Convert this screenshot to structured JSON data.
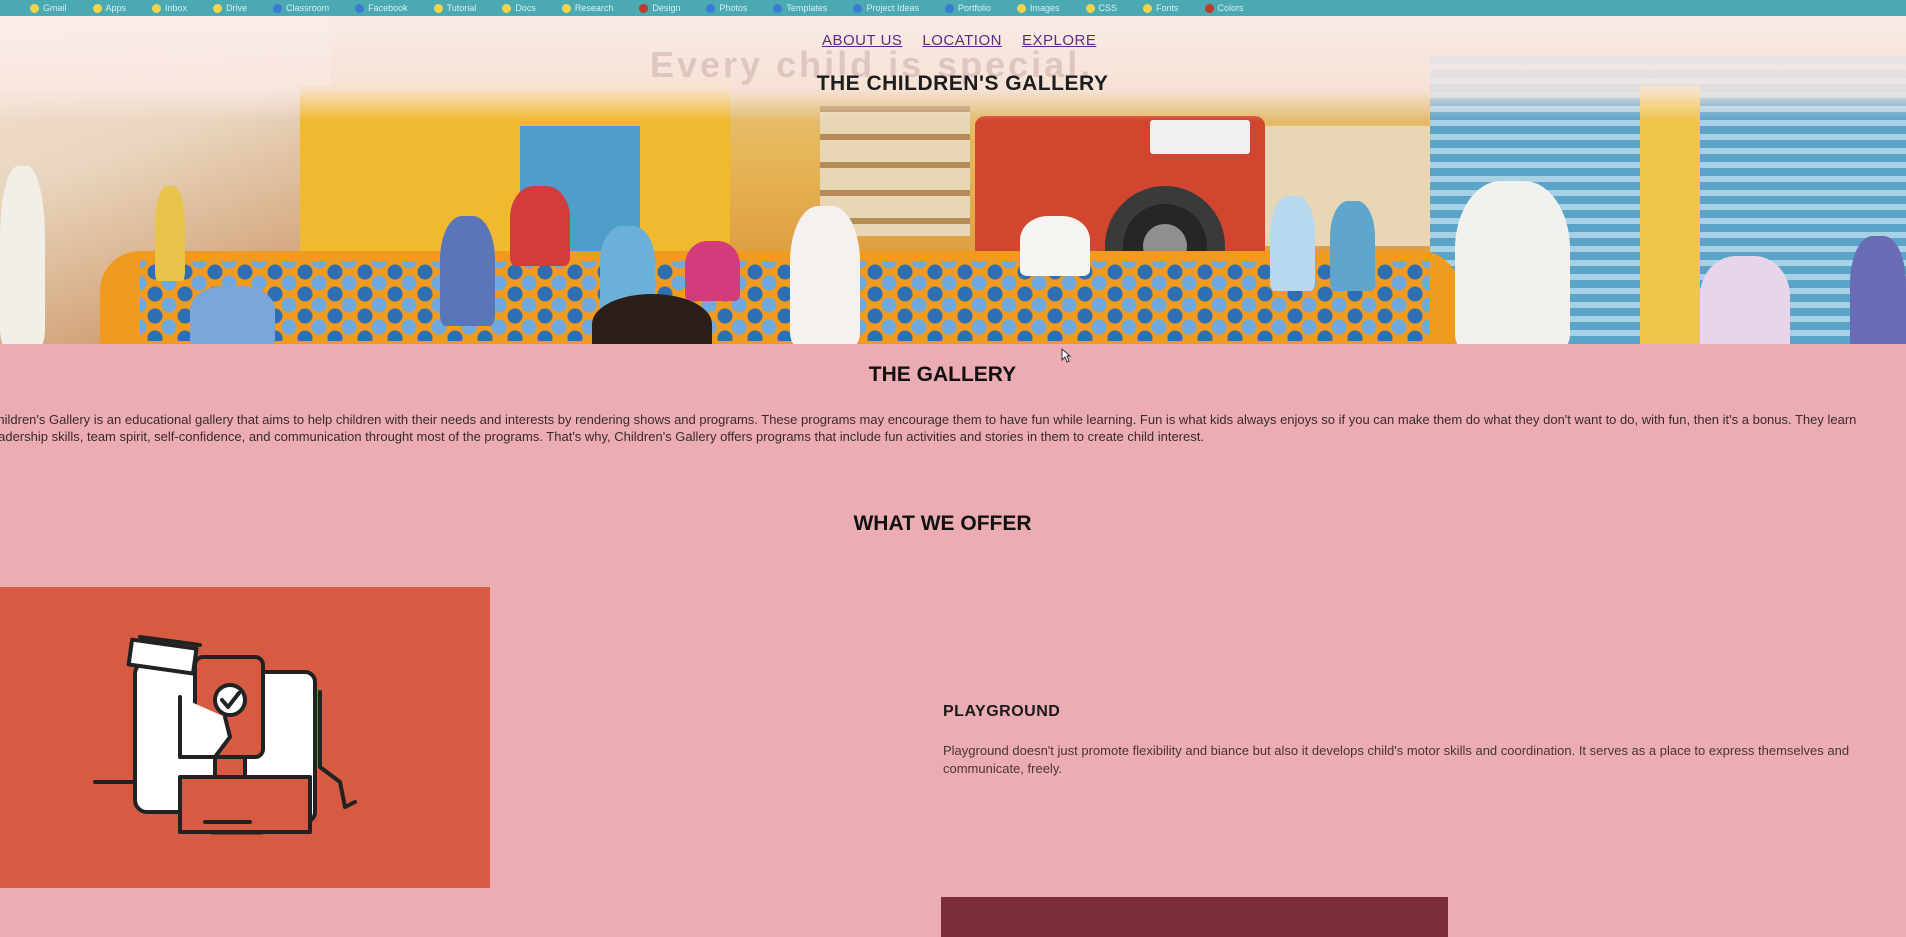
{
  "browser": {
    "bookmarks": [
      {
        "label": "Gmail",
        "color": "#f2d34a"
      },
      {
        "label": "Apps",
        "color": "#f2d34a"
      },
      {
        "label": "Inbox",
        "color": "#f2d34a"
      },
      {
        "label": "Drive",
        "color": "#f2d34a"
      },
      {
        "label": "Classroom",
        "color": "#3a7bd5"
      },
      {
        "label": "Facebook",
        "color": "#3a7bd5"
      },
      {
        "label": "Tutorial",
        "color": "#f2d34a"
      },
      {
        "label": "Docs",
        "color": "#f2d34a"
      },
      {
        "label": "Research",
        "color": "#f2d34a"
      },
      {
        "label": "Design",
        "color": "#c0392b"
      },
      {
        "label": "Photos",
        "color": "#3a7bd5"
      },
      {
        "label": "Templates",
        "color": "#3a7bd5"
      },
      {
        "label": "Project Ideas",
        "color": "#3a7bd5"
      },
      {
        "label": "Portfolio",
        "color": "#3a7bd5"
      },
      {
        "label": "Images",
        "color": "#f2d34a"
      },
      {
        "label": "CSS",
        "color": "#f2d34a"
      },
      {
        "label": "Fonts",
        "color": "#f2d34a"
      },
      {
        "label": "Colors",
        "color": "#c0392b"
      }
    ]
  },
  "hero": {
    "watermark": "Every child is special."
  },
  "nav": {
    "items": [
      "ABOUT US",
      "LOCATION",
      "EXPLORE"
    ]
  },
  "site": {
    "title": "THE CHILDREN'S GALLERY"
  },
  "gallery": {
    "heading": "THE GALLERY",
    "text": "Children's Gallery is an educational gallery that aims to help children with their needs and interests by rendering shows and programs. These programs may encourage them to have fun while learning. Fun is what kids always enjoys so if you can make them do what they don't want to do, with fun, then it's a bonus. They learn leadership skills, team spirit, self-confidence, and communication throught most of the programs. That's why, Children's Gallery offers programs that include fun activities and stories in them to create child interest."
  },
  "offer": {
    "heading": "WHAT WE OFFER",
    "title": "PLAYGROUND",
    "text": "Playground doesn't just promote flexibility and biance but also it develops child's motor skills and coordination. It serves as a place to express themselves and communicate, freely.",
    "image_bg": "#d75a43",
    "button_color": "#7c2d39"
  },
  "colors": {
    "page_bg": "#ebadb3",
    "bookmark_bar": "#4aa9b2",
    "nav_link": "#5b2a8a"
  }
}
